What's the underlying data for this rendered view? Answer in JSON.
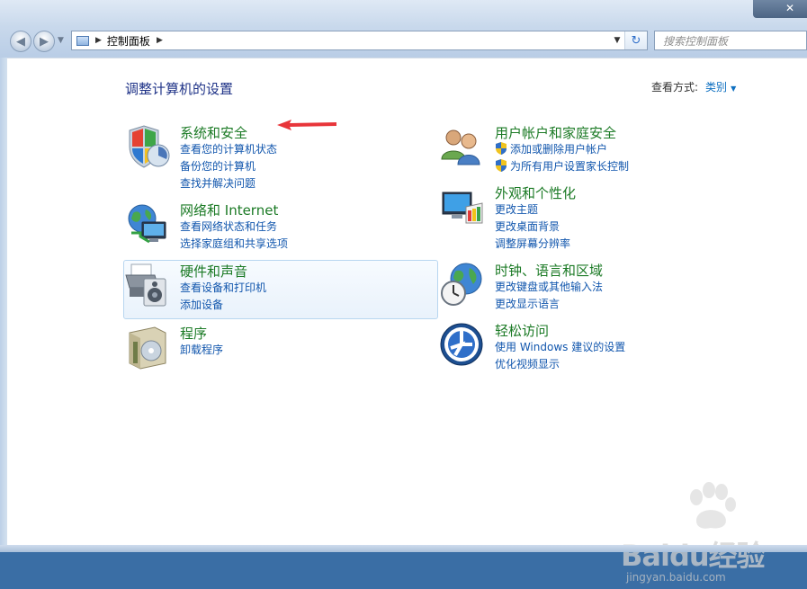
{
  "window": {
    "address_path": "控制面板",
    "search_placeholder": "搜索控制面板",
    "close_label": "✕"
  },
  "page": {
    "title": "调整计算机的设置",
    "view_by_label": "查看方式:",
    "view_by_value": "类别"
  },
  "categories": [
    {
      "title": "系统和安全",
      "links": [
        "查看您的计算机状态",
        "备份您的计算机",
        "查找并解决问题"
      ]
    },
    {
      "title": "网络和 Internet",
      "links": [
        "查看网络状态和任务",
        "选择家庭组和共享选项"
      ]
    },
    {
      "title": "硬件和声音",
      "links": [
        "查看设备和打印机",
        "添加设备"
      ]
    },
    {
      "title": "程序",
      "links": [
        "卸载程序"
      ]
    },
    {
      "title": "用户帐户和家庭安全",
      "links": [
        "添加或删除用户帐户",
        "为所有用户设置家长控制"
      ]
    },
    {
      "title": "外观和个性化",
      "links": [
        "更改主题",
        "更改桌面背景",
        "调整屏幕分辨率"
      ]
    },
    {
      "title": "时钟、语言和区域",
      "links": [
        "更改键盘或其他输入法",
        "更改显示语言"
      ]
    },
    {
      "title": "轻松访问",
      "links": [
        "使用 Windows 建议的设置",
        "优化视频显示"
      ]
    }
  ],
  "colors": {
    "link": "#1156ad",
    "category_title": "#1b7a25",
    "page_title": "#1e3287",
    "annotation_arrow": "#e8353a"
  },
  "watermark": {
    "logo": "Baidu经验",
    "url": "jingyan.baidu.com"
  }
}
